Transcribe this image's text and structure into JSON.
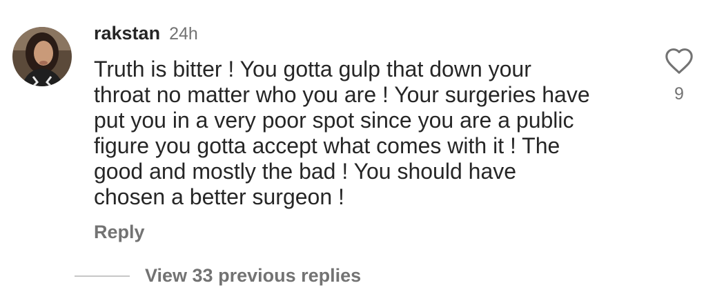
{
  "comment": {
    "author": "rakstan",
    "time": "24h",
    "text_lines": [
      "Truth is bitter ! You gotta gulp that down your",
      "throat no matter who you are ! Your surgeries have",
      "put you in a very poor spot since you are a public",
      "figure you gotta accept what comes with it ! The",
      "good and mostly the bad ! You should have",
      "chosen a better surgeon !"
    ],
    "reply_label": "Reply",
    "like_count": "9",
    "like_icon": "heart-outline-icon",
    "avatar_icon": "user-avatar"
  },
  "replies": {
    "view_label": "View 33 previous replies"
  },
  "colors": {
    "primary_text": "#262626",
    "secondary_text": "#737373",
    "divider": "#c7c7c7",
    "background": "#ffffff"
  }
}
